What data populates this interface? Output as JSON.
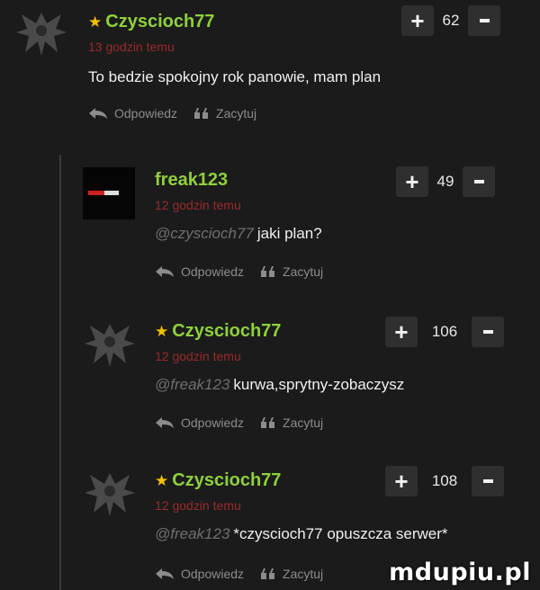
{
  "comments": [
    {
      "author": "Czyscioch77",
      "starred": true,
      "time": "13 godzin temu",
      "mention": "",
      "text": "To bedzie spokojny rok panowie, mam plan",
      "score": "62",
      "avatar_icon": "bat-demon-avatar",
      "reply_label": "Odpowiedz",
      "quote_label": "Zacytuj"
    },
    {
      "author": "freak123",
      "starred": false,
      "time": "12 godzin temu",
      "mention": "@czyscioch77",
      "text": "jaki plan?",
      "score": "49",
      "avatar_icon": "dark-banner-avatar",
      "reply_label": "Odpowiedz",
      "quote_label": "Zacytuj"
    },
    {
      "author": "Czyscioch77",
      "starred": true,
      "time": "12 godzin temu",
      "mention": "@freak123",
      "text": "kurwa,sprytny-zobaczysz",
      "score": "106",
      "avatar_icon": "bat-demon-avatar",
      "reply_label": "Odpowiedz",
      "quote_label": "Zacytuj"
    },
    {
      "author": "Czyscioch77",
      "starred": true,
      "time": "12 godzin temu",
      "mention": "@freak123",
      "text": "*czyscioch77 opuszcza serwer*",
      "score": "108",
      "avatar_icon": "bat-demon-avatar",
      "reply_label": "Odpowiedz",
      "quote_label": "Zacytuj"
    }
  ],
  "colors": {
    "background": "#1b1b1b",
    "author": "#8fd13a",
    "star": "#f2c200",
    "time": "#9a2a2a",
    "vote_button": "#2f2f2f"
  },
  "watermark": "mdupiu.pl"
}
